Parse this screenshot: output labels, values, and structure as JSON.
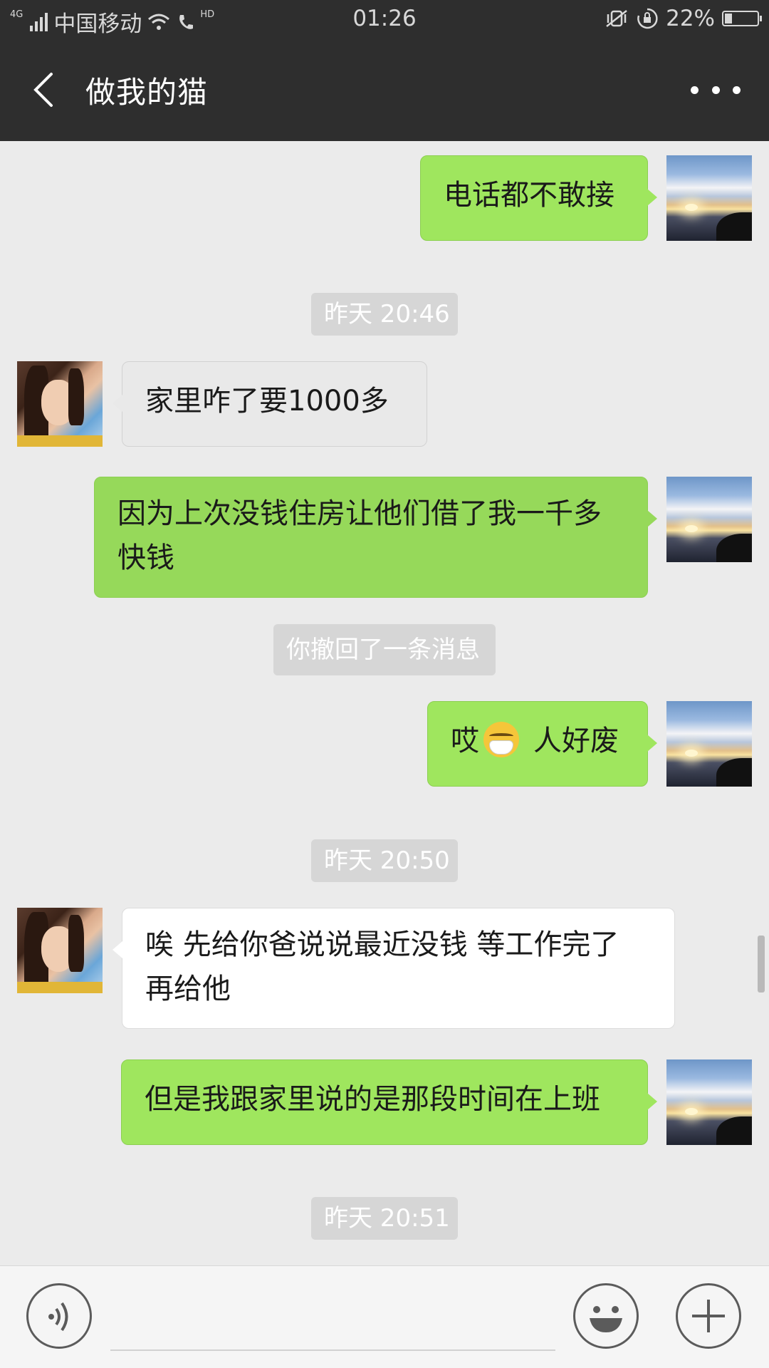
{
  "status_bar": {
    "network": "4G",
    "carrier": "中国移动",
    "hd": "HD",
    "time": "01:26",
    "battery_percent": "22%",
    "battery_level": 0.22
  },
  "header": {
    "title": "做我的猫"
  },
  "messages": [
    {
      "type": "text",
      "side": "me",
      "text": "电话都不敢接"
    },
    {
      "type": "time",
      "text": "昨天 20:46"
    },
    {
      "type": "text",
      "side": "other",
      "text": "家里咋了要1000多"
    },
    {
      "type": "text",
      "side": "me",
      "line1": "因为上次没钱住房让他们借了我一千多",
      "line2": "快钱"
    },
    {
      "type": "system",
      "text": "你撤回了一条消息"
    },
    {
      "type": "text",
      "side": "me",
      "before_emoji": "哎",
      "emoji": "mask-face-emoji",
      "after_emoji": "人好废"
    },
    {
      "type": "time",
      "text": "昨天 20:50"
    },
    {
      "type": "text",
      "side": "other",
      "line1": "唉 先给你爸说说最近没钱 等工作完了",
      "line2": "再给他"
    },
    {
      "type": "text",
      "side": "me",
      "text": "但是我跟家里说的是那段时间在上班"
    },
    {
      "type": "time",
      "text": "昨天 20:51"
    }
  ],
  "icons": {
    "back": "back-arrow-icon",
    "more": "more-dots-icon",
    "voice": "voice-icon",
    "emoji": "emoji-icon",
    "plus": "plus-icon"
  },
  "colors": {
    "header_bg": "#2e2e2e",
    "chat_bg": "#ebebeb",
    "my_bubble": "#9fe65e",
    "other_bubble": "#ffffff",
    "time_chip": "#d6d6d6"
  }
}
